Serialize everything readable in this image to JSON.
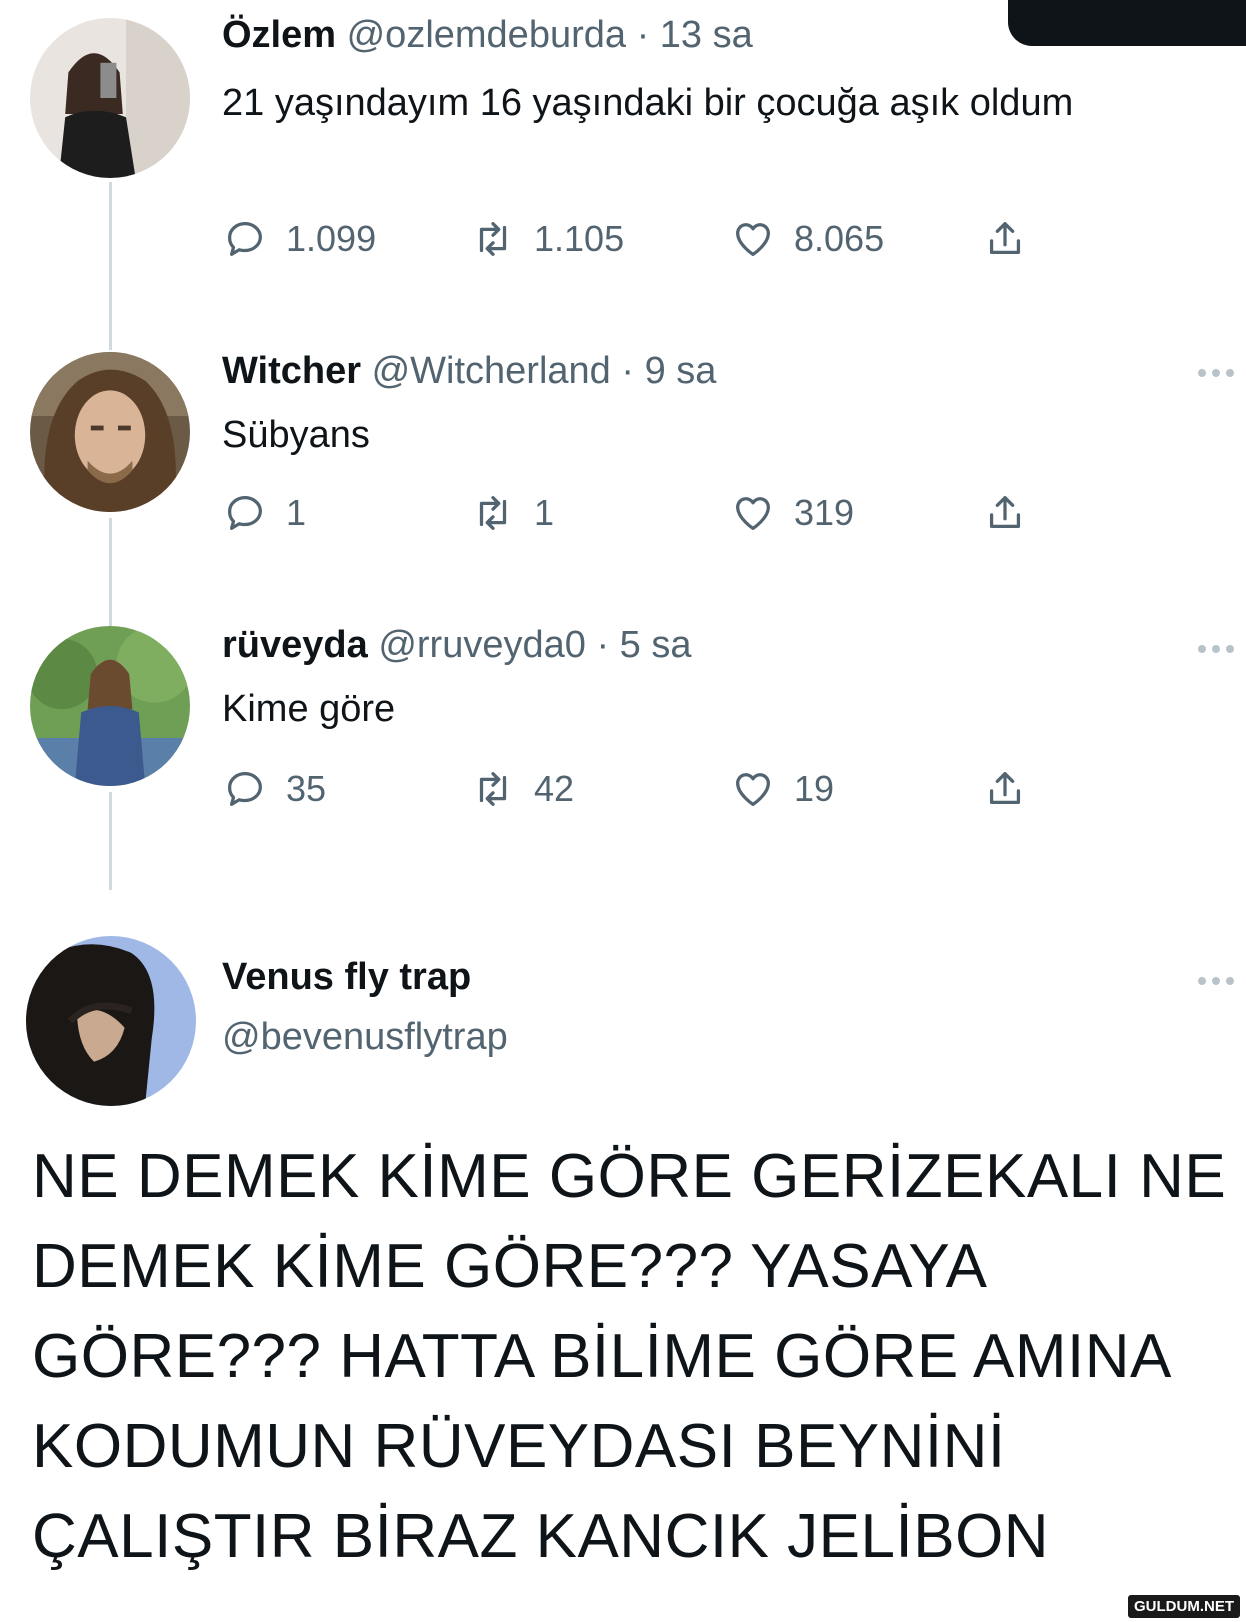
{
  "tweets": [
    {
      "name": "Özlem",
      "handle": "@ozlemdeburda",
      "dot": "·",
      "time": "13 sa",
      "text": "21 yaşındayım 16 yaşındaki bir çocuğa aşık oldum",
      "replies": "1.099",
      "retweets": "1.105",
      "likes": "8.065"
    },
    {
      "name": "Witcher",
      "handle": "@Witcherland",
      "dot": "·",
      "time": "9 sa",
      "text": "Sübyans",
      "replies": "1",
      "retweets": "1",
      "likes": "319"
    },
    {
      "name": "rüveyda",
      "handle": "@rruveyda0",
      "dot": "·",
      "time": "5 sa",
      "text": "Kime göre",
      "replies": "35",
      "retweets": "42",
      "likes": "19"
    }
  ],
  "main_tweet": {
    "name": "Venus fly trap",
    "handle": "@bevenusflytrap",
    "text": "NE DEMEK KİME GÖRE GERİZEKALI NE DEMEK KİME GÖRE??? YASAYA GÖRE??? HATTA BİLİME GÖRE AMINA KODUMUN RÜVEYDASI BEYNİNİ ÇALIŞTIR BİRAZ KANCIK JELİBON"
  },
  "watermark": "GULDUM.NET",
  "icons": {
    "reply": "speech-bubble-icon",
    "retweet": "retweet-arrows-icon",
    "like": "heart-icon",
    "share": "share-upload-icon",
    "more": "more-dots-icon"
  },
  "colors": {
    "text": "#0f1419",
    "secondary": "#536471",
    "thread_line": "#cfd9de"
  }
}
